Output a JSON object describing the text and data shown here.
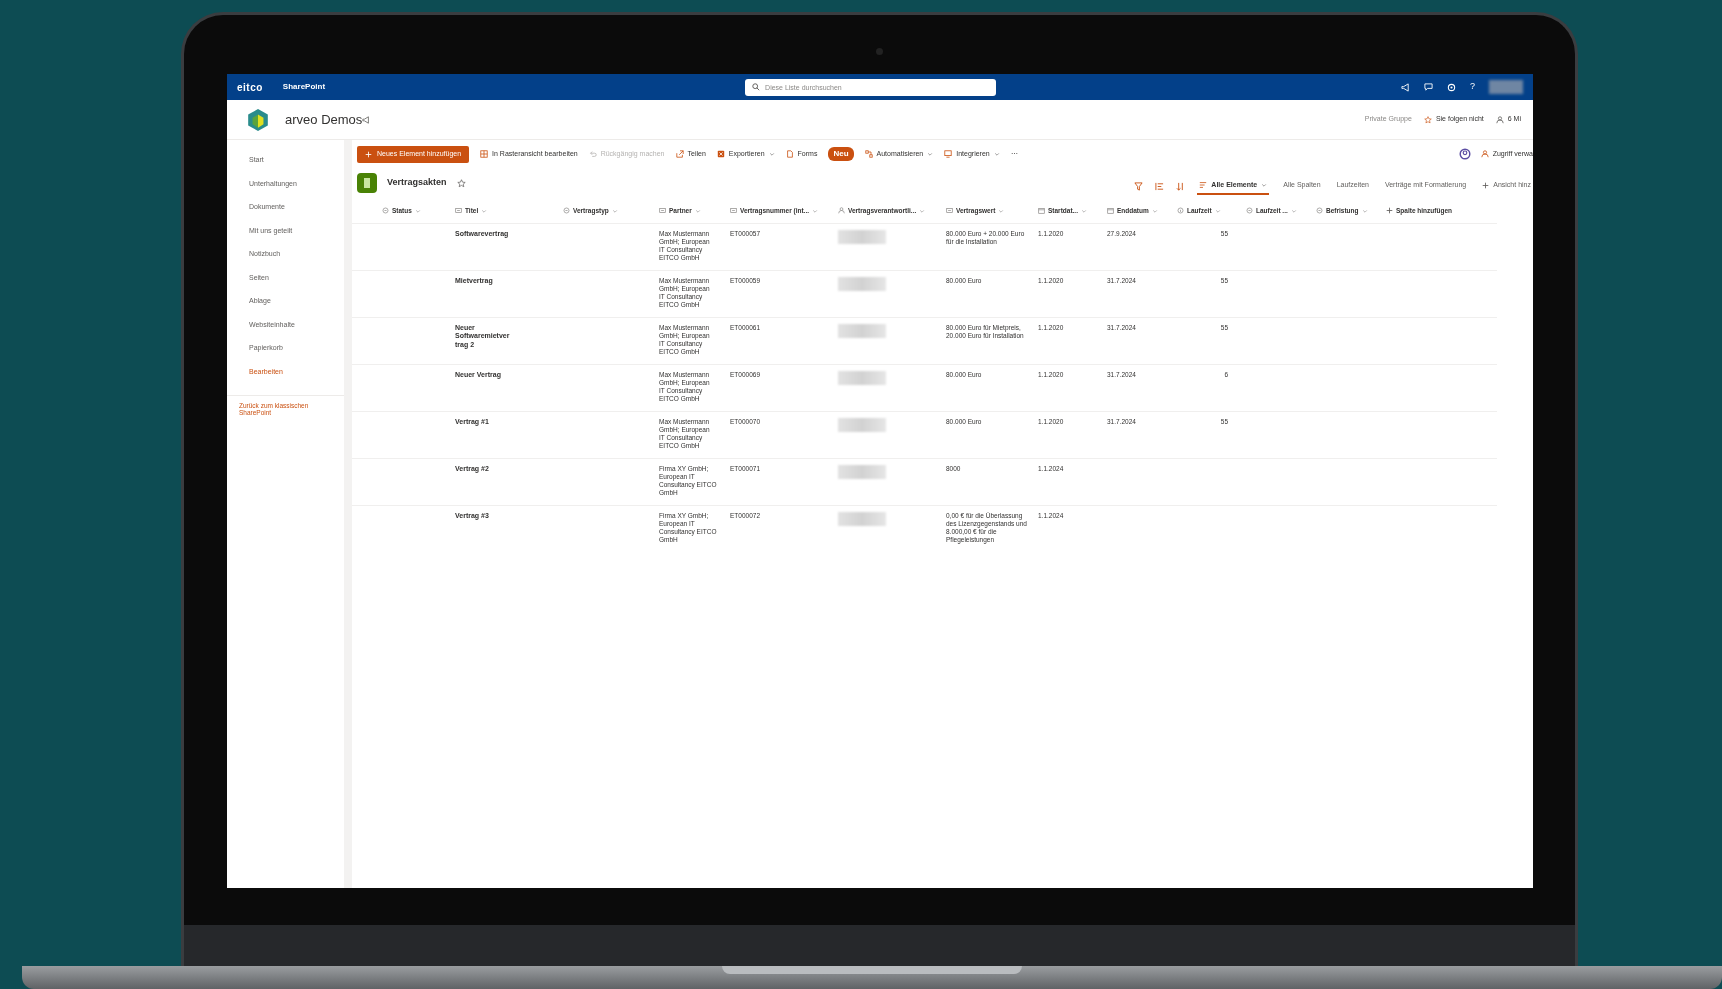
{
  "suite_bar": {
    "logo": "eitco",
    "app": "SharePoint",
    "search": {
      "placeholder": "Diese Liste durchsuchen"
    },
    "help": "?",
    "avatar_blurred": true
  },
  "site": {
    "title": "arveo Demos",
    "group": "Private Gruppe",
    "follow": "Sie folgen nicht",
    "members": "6 Mi"
  },
  "sidebar": {
    "items": [
      "Start",
      "Unterhaltungen",
      "Dokumente",
      "Mit uns geteilt",
      "Notizbuch",
      "Seiten",
      "Ablage",
      "Websiteinhalte",
      "Papierkorb"
    ],
    "edit_link": "Bearbeiten",
    "classic_link": "Zurück zum klassischen SharePoint"
  },
  "command_bar": {
    "new_button": "Neues Element hinzufügen",
    "items": [
      {
        "label": "In Rasteransicht bearbeiten",
        "disabled": false,
        "dropdown": false
      },
      {
        "label": "Rückgängig machen",
        "disabled": true,
        "dropdown": false
      },
      {
        "label": "Teilen",
        "disabled": false,
        "dropdown": false
      },
      {
        "label": "Exportieren",
        "disabled": false,
        "dropdown": true
      },
      {
        "label": "Forms",
        "disabled": false,
        "dropdown": false,
        "badge": "Neu"
      },
      {
        "label": "Automatisieren",
        "disabled": false,
        "dropdown": true
      },
      {
        "label": "Integrieren",
        "disabled": false,
        "dropdown": true
      }
    ],
    "more": "⋯",
    "access": "Zugriff verwa"
  },
  "list": {
    "title": "Vertragsakten",
    "favorite": false
  },
  "views": [
    {
      "label": "Alle Elemente",
      "selected": true
    },
    {
      "label": "Alle Spalten",
      "selected": false
    },
    {
      "label": "Laufzeiten",
      "selected": false
    },
    {
      "label": "Verträge mit Formatierung",
      "selected": false
    }
  ],
  "add_view": "Ansicht hinz",
  "table": {
    "columns": [
      {
        "label": "Status",
        "kind": "choice"
      },
      {
        "label": "Titel",
        "kind": "text"
      },
      {
        "label": "Vertragstyp",
        "kind": "choice"
      },
      {
        "label": "Partner",
        "kind": "text"
      },
      {
        "label": "Vertragsnummer (int...",
        "kind": "text"
      },
      {
        "label": "Vertragsverantwortli...",
        "kind": "person"
      },
      {
        "label": "Vertragswert",
        "kind": "text"
      },
      {
        "label": "Startdat...",
        "kind": "date"
      },
      {
        "label": "Enddatum",
        "kind": "date"
      },
      {
        "label": "Laufzeit",
        "kind": "number"
      },
      {
        "label": "Laufzeit ...",
        "kind": "choice"
      },
      {
        "label": "Befristung",
        "kind": "choice"
      }
    ],
    "add_column": "Spalte hinzufügen",
    "rows": [
      {
        "title": "Softwarevertrag",
        "partner": "Max Mustermann GmbH; European IT Consultancy EITCO GmbH",
        "number": "ET000057",
        "owner_blurred": true,
        "value": "80.000 Euro + 20.000 Euro für die Installation",
        "start": "1.1.2020",
        "end": "27.9.2024",
        "duration": "55"
      },
      {
        "title": "Mietvertrag",
        "partner": "Max Mustermann GmbH; European IT Consultancy EITCO GmbH",
        "number": "ET000059",
        "owner_blurred": true,
        "value": "80.000 Euro",
        "start": "1.1.2020",
        "end": "31.7.2024",
        "duration": "55"
      },
      {
        "title": "Neuer Softwaremietver trag 2",
        "partner": "Max Mustermann GmbH; European IT Consultancy EITCO GmbH",
        "number": "ET000061",
        "owner_blurred": true,
        "value": "80.000 Euro für Mietpreis, 20.000 Euro für Installation",
        "start": "1.1.2020",
        "end": "31.7.2024",
        "duration": "55"
      },
      {
        "title": "Neuer Vertrag",
        "partner": "Max Mustermann GmbH; European IT Consultancy EITCO GmbH",
        "number": "ET000069",
        "owner_blurred": true,
        "value": "80.000 Euro",
        "start": "1.1.2020",
        "end": "31.7.2024",
        "duration": "6"
      },
      {
        "title": "Vertrag #1",
        "partner": "Max Mustermann GmbH; European IT Consultancy EITCO GmbH",
        "number": "ET000070",
        "owner_blurred": true,
        "value": "80.000 Euro",
        "start": "1.1.2020",
        "end": "31.7.2024",
        "duration": "55"
      },
      {
        "title": "Vertrag #2",
        "partner": "Firma XY GmbH; European IT Consultancy EITCO GmbH",
        "number": "ET000071",
        "owner_blurred": true,
        "value": "8000",
        "start": "1.1.2024"
      },
      {
        "title": "Vertrag #3",
        "partner": "Firma XY GmbH; European IT Consultancy EITCO GmbH",
        "number": "ET000072",
        "owner_blurred": true,
        "value": "0,00 € für die Überlassung des Lizenzgegenstands und 8.000,00 € für die Pflegeleistungen",
        "start": "1.1.2024"
      }
    ]
  }
}
